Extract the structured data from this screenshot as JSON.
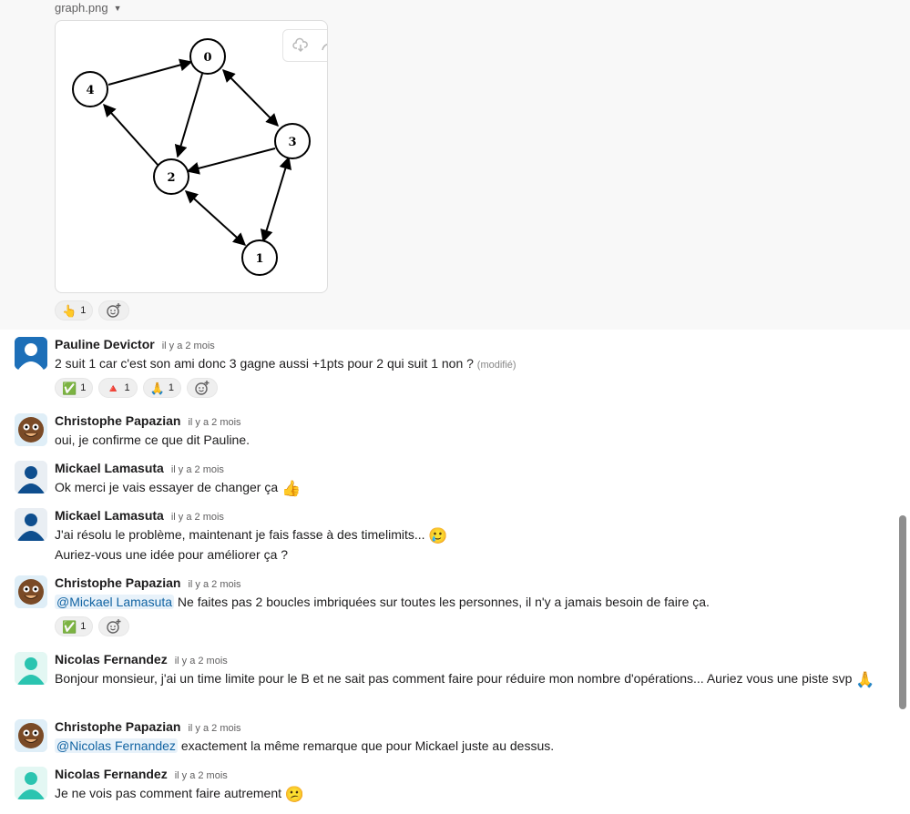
{
  "file": {
    "name": "graph.png"
  },
  "graph_nodes": [
    "0",
    "1",
    "2",
    "3",
    "4"
  ],
  "image_reactions": [
    {
      "emoji": "👆",
      "count": "1"
    }
  ],
  "messages": [
    {
      "author": "Pauline Devictor",
      "time": "il y a 2 mois",
      "text": "2 suit 1 car c'est son ami donc 3 gagne aussi +1pts pour 2 qui suit 1 non ?",
      "edited": "(modifié)",
      "reactions": [
        {
          "emoji": "✅",
          "count": "1"
        },
        {
          "emoji": "🔺",
          "count": "1"
        },
        {
          "emoji": "🙏",
          "count": "1"
        }
      ]
    },
    {
      "author": "Christophe Papazian",
      "time": "il y a 2 mois",
      "text": "oui, je confirme ce que dit Pauline."
    },
    {
      "author": "Mickael Lamasuta",
      "time": "il y a 2 mois",
      "text": "Ok merci je vais essayer de changer ça",
      "emoji": "👍"
    },
    {
      "author": "Mickael Lamasuta",
      "time": "il y a 2 mois",
      "text": "J'ai résolu le problème, maintenant je fais fasse à des timelimits...",
      "emoji": "🥲",
      "text2": "Auriez-vous une idée pour améliorer ça ?"
    },
    {
      "author": "Christophe Papazian",
      "time": "il y a 2 mois",
      "mention": "@Mickael Lamasuta",
      "text": " Ne faites pas 2 boucles imbriquées sur toutes les personnes, il n'y a jamais besoin de faire ça.",
      "reactions": [
        {
          "emoji": "✅",
          "count": "1"
        }
      ]
    },
    {
      "author": "Nicolas Fernandez",
      "time": "il y a 2 mois",
      "text": "Bonjour monsieur, j'ai un time limite pour le B et ne sait pas comment faire pour réduire mon nombre d'opérations... Auriez vous une piste svp",
      "emoji": "🙏"
    },
    {
      "author": "Christophe Papazian",
      "time": "il y a 2 mois",
      "mention": "@Nicolas Fernandez",
      "text": " exactement la même remarque que pour Mickael juste au dessus."
    },
    {
      "author": "Nicolas Fernandez",
      "time": "il y a 2 mois",
      "text": "Je ne vois pas comment faire autrement",
      "emoji": "😕"
    }
  ],
  "colors": {
    "mention_bg": "#e8f2fa",
    "mention_text": "#1264a3",
    "avatar_blue": "#1d6fb8",
    "avatar_navy": "#0e4e8e",
    "avatar_teal": "#2bc4b0"
  }
}
